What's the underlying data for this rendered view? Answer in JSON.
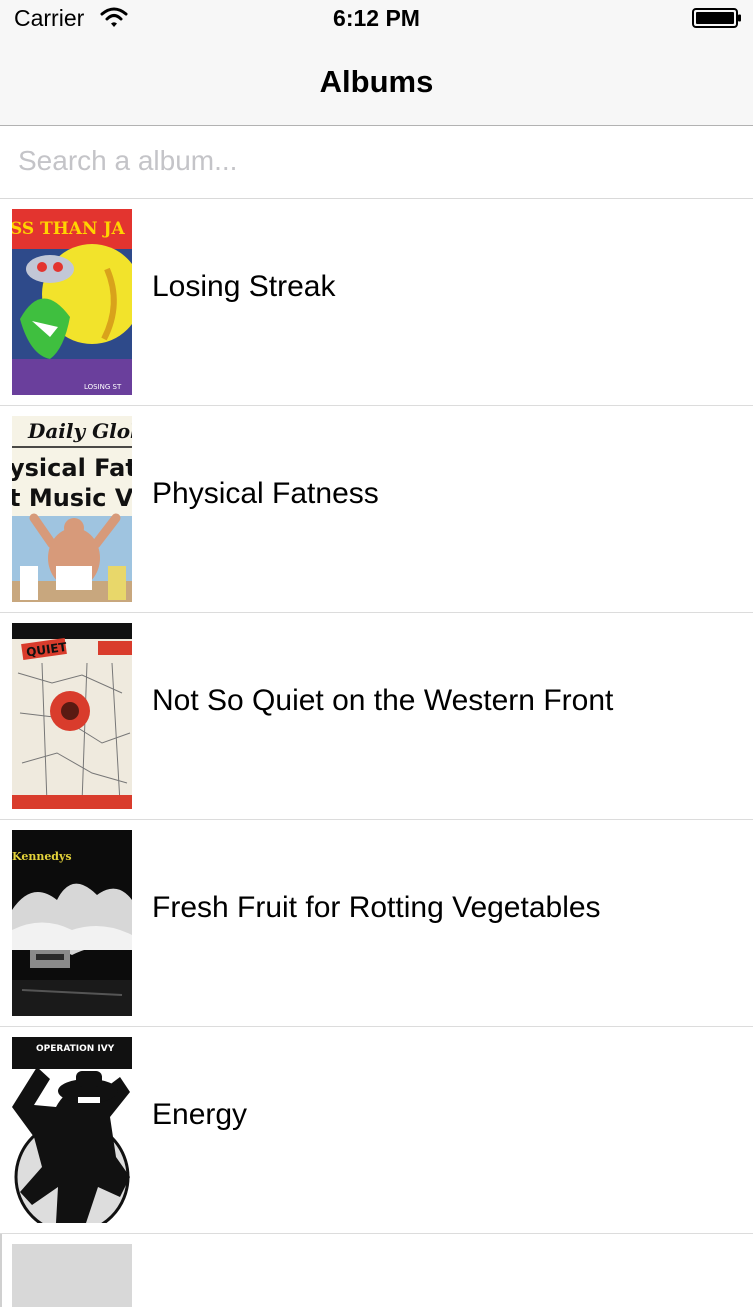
{
  "status_bar": {
    "carrier": "Carrier",
    "time": "6:12 PM",
    "wifi_icon": "wifi-icon",
    "battery_icon": "battery-full-icon"
  },
  "nav": {
    "title": "Albums"
  },
  "search": {
    "placeholder": "Search a album...",
    "value": ""
  },
  "albums": [
    {
      "title": "Losing Streak",
      "art_text": "SS THAN JA"
    },
    {
      "title": "Physical Fatness",
      "art_text": [
        "Daily Glob",
        "ysical Fatne",
        "t Music Vol."
      ]
    },
    {
      "title": "Not So Quiet on the Western Front",
      "art_text": "QUIET"
    },
    {
      "title": "Fresh Fruit for Rotting Vegetables",
      "art_text": "Kennedys"
    },
    {
      "title": "Energy",
      "art_text": "OPERATION IVY"
    }
  ],
  "colors": {
    "nav_background": "#f7f7f7",
    "separator": "#dcdcdc",
    "placeholder": "#c4c4c8"
  }
}
